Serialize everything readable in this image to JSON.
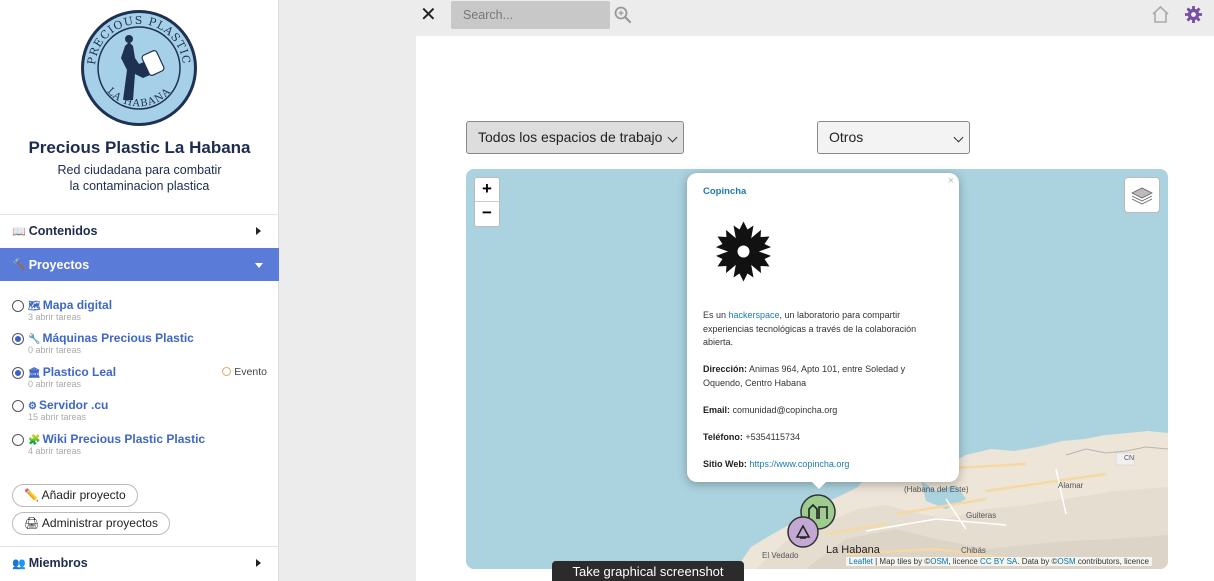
{
  "sidebar": {
    "logo_text_top": "PRECIOUS PLASTIC",
    "logo_text_bottom": "LA HABANA",
    "title": "Precious Plastic La Habana",
    "subtitle_line1": "Red ciudadana para combatir",
    "subtitle_line2": "la contaminacion plastica",
    "sections": {
      "contenidos": {
        "emoji": "📖",
        "label": "Contenidos"
      },
      "proyectos": {
        "emoji": "🔨",
        "label": "Proyectos"
      },
      "miembros": {
        "emoji": "👥",
        "label": "Miembros"
      }
    },
    "projects": [
      {
        "icon": "🗺",
        "name": "Mapa digital",
        "tasks": "3 abrir tareas",
        "selected": false
      },
      {
        "icon": "🔧",
        "name": "Máquinas Precious Plastic",
        "tasks": "0 abrir tareas",
        "selected": true
      },
      {
        "icon": "🏛",
        "name": "Plastico Leal",
        "tasks": "0 abrir tareas",
        "selected": true,
        "badge": "Evento"
      },
      {
        "icon": "⚙",
        "name": "Servidor .cu",
        "tasks": "15 abrir tareas",
        "selected": false
      },
      {
        "icon": "🧩",
        "name": "Wiki Precious Plastic Plastic",
        "tasks": "4 abrir tareas",
        "selected": false
      }
    ],
    "add_project": "✏️ Añadir proyecto",
    "manage_projects": "🖨 Administrar proyectos"
  },
  "topbar": {
    "close": "✕",
    "search_placeholder": "Search..."
  },
  "filters": {
    "workspace_selected": "Todos los espacios de trabajo",
    "category_selected": "Otros"
  },
  "map": {
    "zoom_in": "+",
    "zoom_out": "−",
    "labels": {
      "habana_este": "(Habana del Este)",
      "alamar": "Alamar",
      "guiteras": "Guiteras",
      "chibas": "Chibás",
      "el_vedado": "El Vedado",
      "la_habana": "La Habana",
      "cn": "CN"
    },
    "attribution": {
      "leaflet": "Leaflet",
      "tiles": " | Map tiles by ©",
      "osm1": "OSM",
      "licence": ", licence ",
      "ccbysa": "CC BY SA",
      "data": ". Data by ©",
      "osm2": "OSM",
      "rest": " contributors, licence"
    }
  },
  "popup": {
    "close": "×",
    "title": "Copincha",
    "desc_pre": "Es un ",
    "desc_link": "hackerspace",
    "desc_post": ", un laboratorio para compartir experiencias tecnológicas a través de la colaboración abierta.",
    "address_label": "Dirección:",
    "address": " Animas 964, Apto 101, entre Soledad y Oquendo, Centro Habana",
    "email_label": "Email:",
    "email": " comunidad@copincha.org",
    "phone_label": "Teléfono:",
    "phone": " +5354115734",
    "web_label": "Sitio Web:",
    "web": "https://www.copincha.org"
  },
  "tooltip": "Take graphical screenshot"
}
